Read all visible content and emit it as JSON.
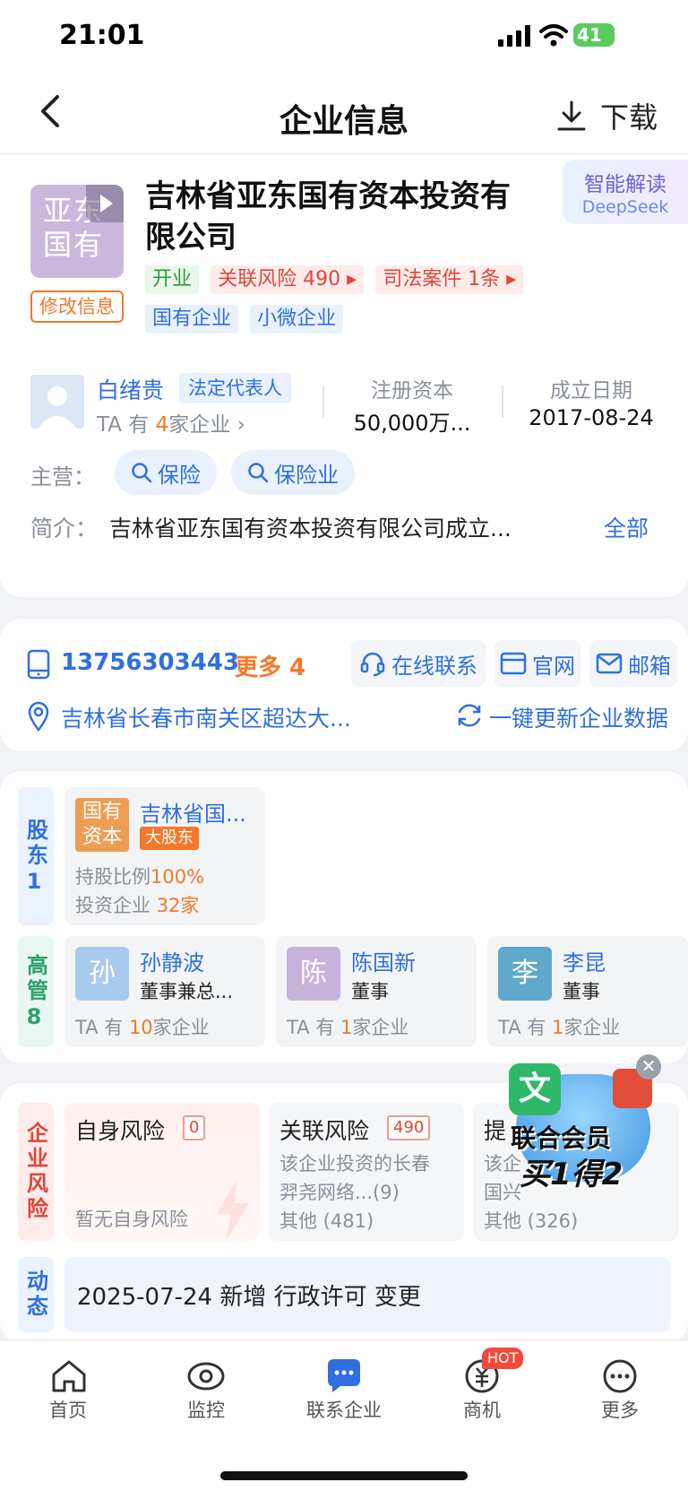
{
  "status": {
    "time": "21:01",
    "battery": "41"
  },
  "nav": {
    "title": "企业信息",
    "download": "下载"
  },
  "company": {
    "logo_line1": "亚东",
    "logo_line2": "国有",
    "edit": "修改信息",
    "name_line1": "吉林省亚东国有资本投资有",
    "name_line2": "限公司",
    "ai_title": "智能解读",
    "ai_sub": "DeepSeek",
    "tags": {
      "status": "开业",
      "risk": "关联风险 490",
      "court": "司法案件 1条",
      "type1": "国有企业",
      "type2": "小微企业"
    },
    "rep": {
      "name": "白绪贵",
      "role": "法定代表人",
      "prefix": "TA 有",
      "count": "4",
      "suffix": "家企业"
    },
    "capital_label": "注册资本",
    "capital_value": "50,000万...",
    "date_label": "成立日期",
    "date_value": "2017-08-24",
    "main_label": "主营：",
    "main_tags": [
      "保险",
      "保险业"
    ],
    "intro_label": "简介：",
    "intro_text": "吉林省亚东国有资本投资有限公司成立...",
    "intro_all": "全部"
  },
  "contact": {
    "phone": "13756303443",
    "more": "更多 4",
    "online": "在线联系",
    "site": "官网",
    "email": "邮箱",
    "address": "吉林省长春市南关区超达大...",
    "refresh": "一键更新企业数据"
  },
  "shareholders": {
    "label": "股东",
    "count": "1",
    "item": {
      "badge_l1": "国有",
      "badge_l2": "资本",
      "name": "吉林省国...",
      "tag": "大股东",
      "ratio_label": "持股比例",
      "ratio_value": "100%",
      "inv_label": "投资企业",
      "inv_value": "32家"
    }
  },
  "managers": {
    "label": "高管",
    "count": "8",
    "items": [
      {
        "avatar": "孙",
        "name": "孙静波",
        "role": "董事兼总...",
        "prefix": "TA 有",
        "count": "10",
        "suffix": "家企业",
        "color": "#a8cbed"
      },
      {
        "avatar": "陈",
        "name": "陈国新",
        "role": "董事",
        "prefix": "TA 有",
        "count": "1",
        "suffix": "家企业",
        "color": "#c6b3da"
      },
      {
        "avatar": "李",
        "name": "李昆",
        "role": "董事",
        "prefix": "TA 有",
        "count": "1",
        "suffix": "家企业",
        "color": "#5fa8c9"
      }
    ]
  },
  "risk": {
    "label": "企业风险",
    "self_title": "自身风险",
    "self_count": "0",
    "self_desc": "暂无自身风险",
    "rel_title": "关联风险",
    "rel_count": "490",
    "rel_desc1": "该企业投资的长春",
    "rel_desc2": "羿尧网络...(9)",
    "rel_other": "其他 (481)",
    "tip_title": "提",
    "tip_desc1": "该企",
    "tip_desc2": "国兴",
    "tip_other": "其他 (326)"
  },
  "promo": {
    "line1": "文",
    "line2": "联合会员",
    "line3": "买1得2"
  },
  "dynamics": {
    "label": "动态",
    "text": "2025-07-24 新增 行政许可 变更"
  },
  "tabs": [
    {
      "label": "首页",
      "icon": "home-icon"
    },
    {
      "label": "监控",
      "icon": "eye-icon"
    },
    {
      "label": "联系企业",
      "icon": "chat-icon"
    },
    {
      "label": "商机",
      "icon": "money-icon",
      "badge": "HOT"
    },
    {
      "label": "更多",
      "icon": "more-icon"
    }
  ]
}
